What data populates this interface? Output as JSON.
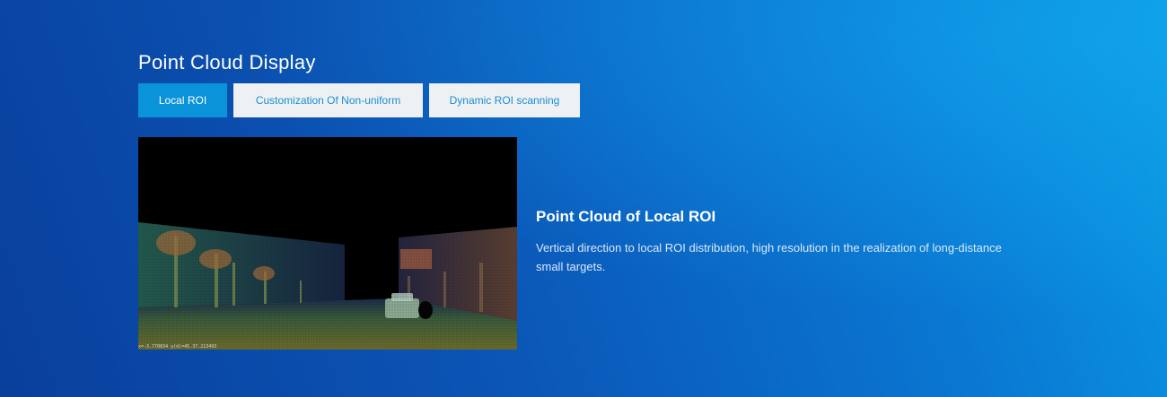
{
  "section": {
    "title": "Point Cloud Display"
  },
  "tabs": [
    {
      "label": "Local ROI",
      "active": true
    },
    {
      "label": "Customization Of Non-uniform",
      "active": false
    },
    {
      "label": "Dynamic ROI scanning",
      "active": false
    }
  ],
  "viewer": {
    "readout": "x=-3.770834   y(d)=45.37.213493"
  },
  "description": {
    "title": "Point Cloud of Local ROI",
    "text": "Vertical direction to local ROI distribution, high resolution in the realization of long-distance small targets."
  },
  "colors": {
    "active_tab_bg": "#0b93da",
    "inactive_tab_bg": "#eef1f4",
    "inactive_tab_text": "#1a8fd1",
    "title_text": "#ffffff"
  }
}
